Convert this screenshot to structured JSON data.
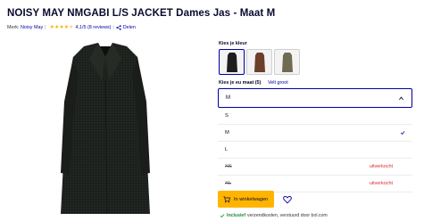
{
  "product": {
    "title": "NOISY MAY NMGABI L/S JACKET Dames Jas - Maat M"
  },
  "meta": {
    "brand_prefix": "Merk:",
    "brand": "Noisy May",
    "rating_stars": 4.5,
    "rating_text": "4,1/5 (8 reviews)",
    "share_label": "Delen"
  },
  "color": {
    "label": "Kies je kleur",
    "swatches": [
      {
        "name": "zwart",
        "color": "#1e1e1e",
        "selected": true
      },
      {
        "name": "bruin",
        "color": "#6b3f2a",
        "selected": false
      },
      {
        "name": "khaki",
        "color": "#6f6a52",
        "selected": false
      }
    ]
  },
  "size": {
    "label": "Kies je eu maat (5)",
    "guide_link": "Velt groot",
    "selected": "M",
    "options": [
      {
        "label": "S",
        "sold_out": false,
        "checked": false,
        "sold_text": ""
      },
      {
        "label": "M",
        "sold_out": false,
        "checked": true,
        "sold_text": ""
      },
      {
        "label": "L",
        "sold_out": false,
        "checked": false,
        "sold_text": ""
      },
      {
        "label": "XS",
        "sold_out": true,
        "checked": false,
        "sold_text": "uitverkocht"
      },
      {
        "label": "XL",
        "sold_out": true,
        "checked": false,
        "sold_text": "uitverkocht"
      }
    ]
  },
  "actions": {
    "cart_label": "In winkelwagen"
  },
  "shipping": {
    "incl": "Inclusief",
    "rest": "verzendkosten, verstuurd door bol.com"
  },
  "colors": {
    "accent": "#0000a4",
    "cart": "#ffb400",
    "sold_out": "#e0262f",
    "stars": "#f5b301",
    "included": "#1d8e31"
  }
}
